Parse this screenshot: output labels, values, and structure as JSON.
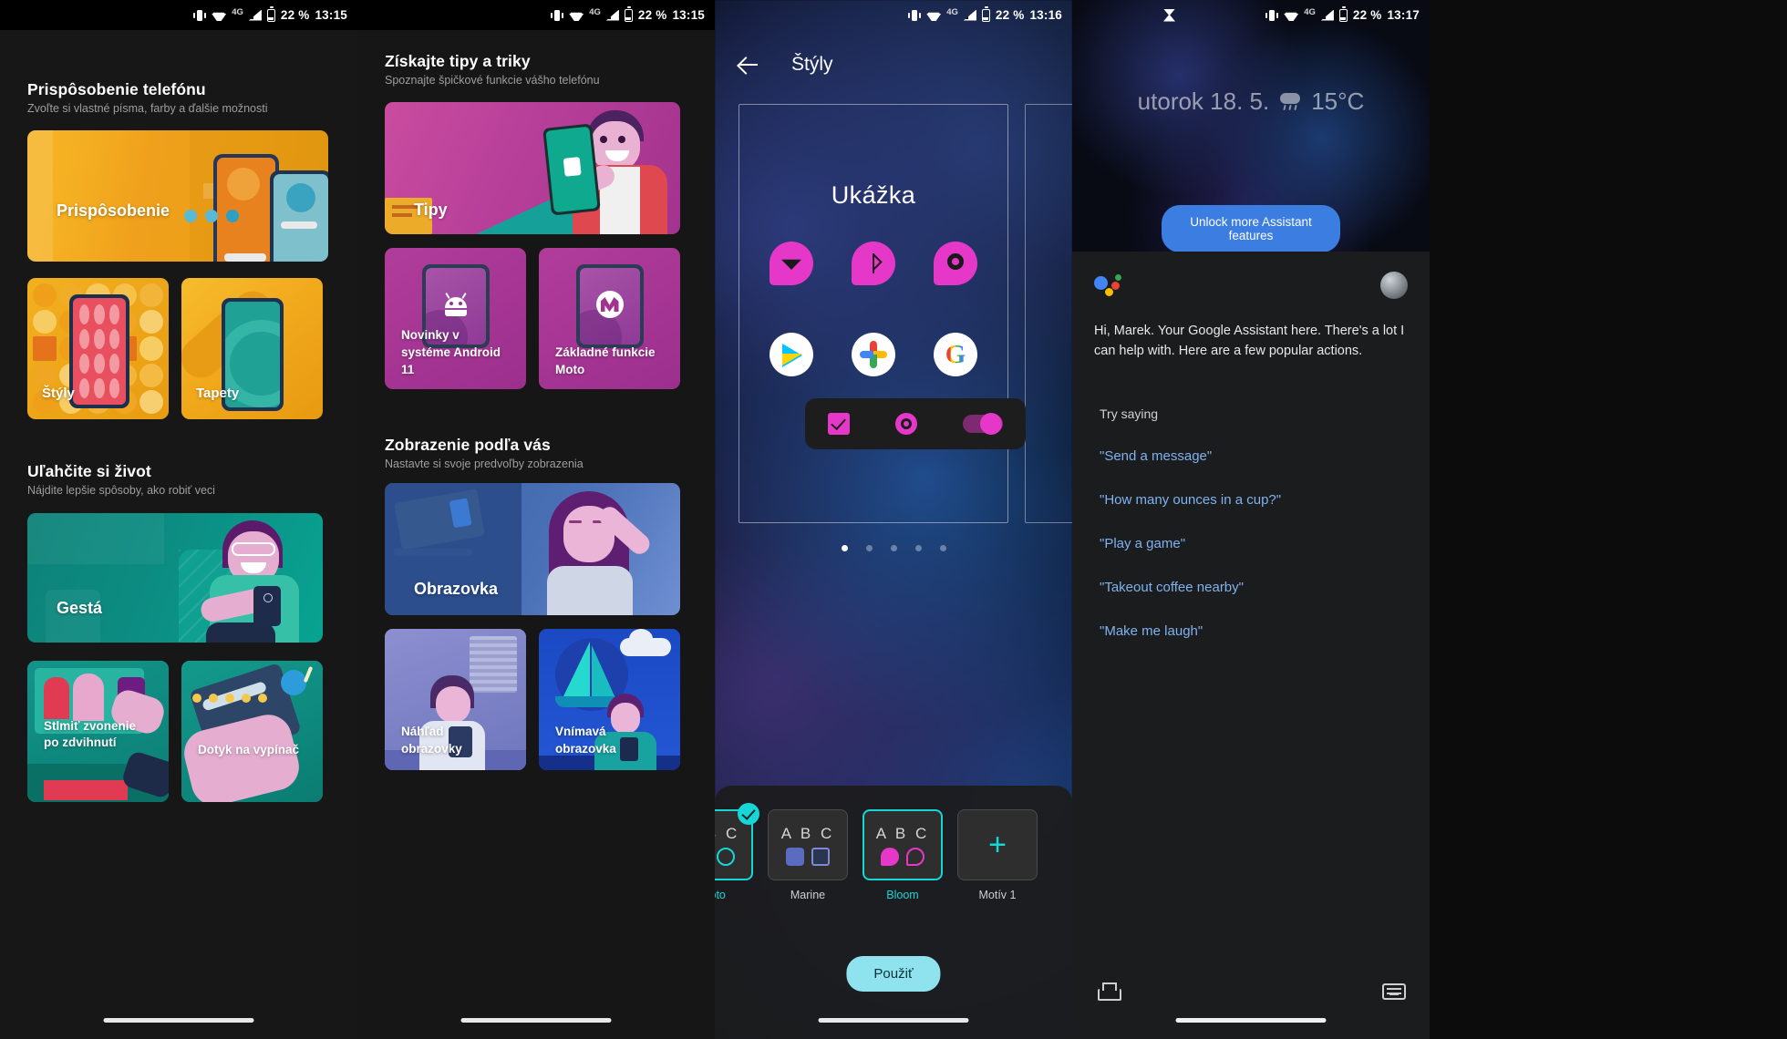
{
  "statusbars": {
    "p1": {
      "battery": "22 %",
      "time": "13:15",
      "network": "4G"
    },
    "p2": {
      "battery": "22 %",
      "time": "13:15",
      "network": "4G"
    },
    "p3": {
      "battery": "22 %",
      "time": "13:16",
      "network": "4G"
    },
    "p4": {
      "battery": "22 %",
      "time": "13:17",
      "network": "4G"
    }
  },
  "panel1": {
    "section1": {
      "title": "Prispôsobenie telefónu",
      "subtitle": "Zvoľte si vlastné písma, farby a ďalšie možnosti",
      "hero_label": "Prispôsobenie",
      "card_styly": "Štýly",
      "card_tapety": "Tapety"
    },
    "section2": {
      "title": "Uľahčite si život",
      "subtitle": "Nájdite lepšie spôsoby, ako robiť veci",
      "hero_label": "Gestá",
      "card_stlmit": "Stlmiť zvonenie\npo zdvihnutí",
      "card_dotyk": "Dotyk na vypínač"
    }
  },
  "panel2": {
    "section1": {
      "title": "Získajte tipy a triky",
      "subtitle": "Spoznajte špičkové funkcie vášho telefónu",
      "hero_label": "Tipy",
      "card_novinky": "Novinky v\nsystéme Android\n11",
      "card_moto": "Základné funkcie\nMoto"
    },
    "section2": {
      "title": "Zobrazenie podľa vás",
      "subtitle": "Nastavte si svoje predvoľby zobrazenia",
      "hero_label": "Obrazovka",
      "card_nahlad": "Náhľad\nobrazovky",
      "card_vnimava": "Vnímavá\nobrazovka"
    }
  },
  "panel3": {
    "title": "Štýly",
    "preview_text": "Ukážka",
    "apply_button": "Použiť",
    "themes": [
      {
        "label": "Moto",
        "abc": "A B C",
        "selected": true
      },
      {
        "label": "Marine",
        "abc": "A B C",
        "selected": false
      },
      {
        "label": "Bloom",
        "abc": "A B C",
        "selected": false
      },
      {
        "label": "Motív 1",
        "abc": "",
        "selected": false
      }
    ],
    "pager_count": 5,
    "pager_active": 0,
    "accent_color": "#e638c8",
    "selection_color": "#19d6d6"
  },
  "panel4": {
    "lockscreen": {
      "date": "utorok 18. 5.",
      "temperature": "15°C",
      "unlock_button": "Unlock more Assistant features"
    },
    "assistant": {
      "greeting": "Hi, Marek. Your Google Assistant here. There's a lot I can help with. Here are a few popular actions.",
      "try_saying": "Try saying",
      "suggestions": [
        "\"Send a message\"",
        "\"How many ounces in a cup?\"",
        "\"Play a game\"",
        "\"Takeout coffee nearby\"",
        "\"Make me laugh\""
      ],
      "link_color": "#7fb2f0"
    }
  }
}
